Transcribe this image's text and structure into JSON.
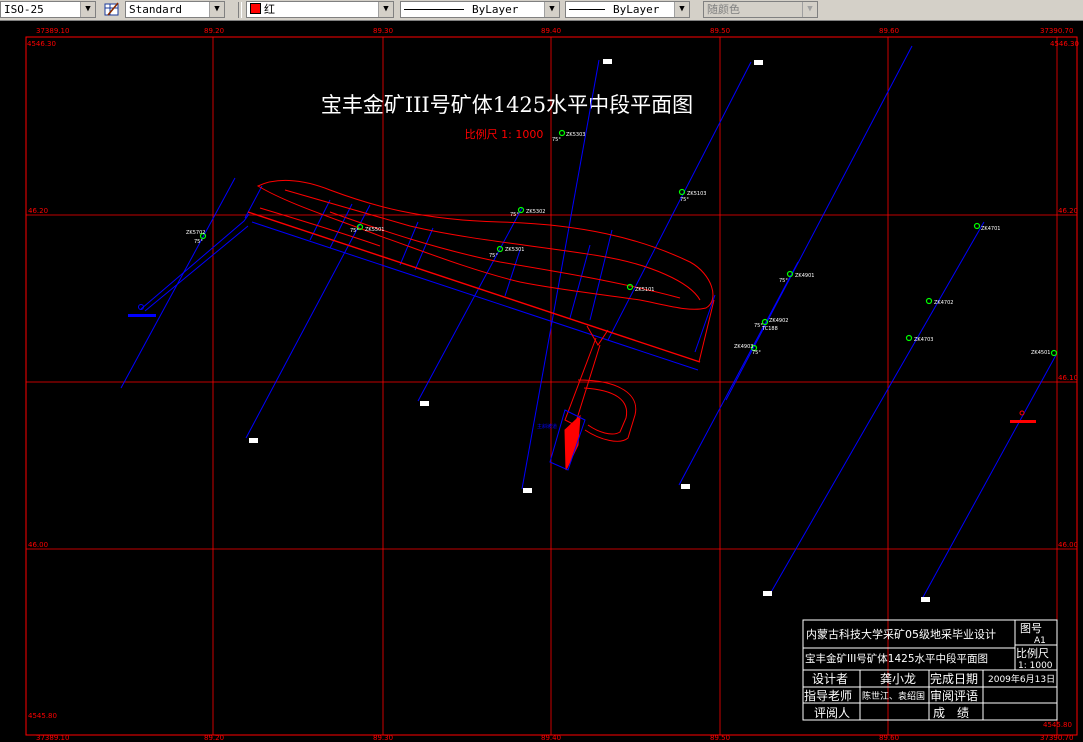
{
  "toolbar": {
    "dimstyle": "ISO-25",
    "tablestyle": "Standard",
    "color": "红",
    "linetype": "ByLayer",
    "lineweight": "ByLayer",
    "plotstyle": "随颜色",
    "icons": [
      "table-style-icon",
      "chevron-down-icon"
    ]
  },
  "drawing": {
    "title": "宝丰金矿III号矿体1425水平中段平面图",
    "scale": "比例尺 1: 1000",
    "colors": {
      "grid": "#ff0000",
      "lines": "#0000ff",
      "ore": "#ff0000",
      "points": "#00ff00",
      "text": "#ffffff"
    },
    "grid_labels": {
      "top_left_x": "37389.10",
      "top_left_y": "4546.30",
      "top_right_x": "37390.70",
      "top_right_y": "4546.30",
      "bottom_left_y": "4545.80",
      "bottom_left_x": "37389.10",
      "bottom_right_y": "4545.80",
      "bottom_right_x": "37390.70",
      "cols": [
        "89.20",
        "89.30",
        "89.40",
        "89.50",
        "89.60"
      ],
      "rows": [
        "46.20",
        "46.10",
        "46.00"
      ]
    },
    "point_labels": [
      "ZK5702",
      "ZK5501",
      "ZK5302",
      "ZK5303",
      "ZK5301",
      "ZK5101",
      "ZK5103",
      "ZK4901",
      "ZK4902",
      "ZK4903",
      "ZK4701",
      "ZK4702",
      "ZK4703",
      "ZK4501"
    ],
    "small_labels": [
      "75°",
      "75°",
      "75°",
      "75°",
      "75°",
      "75°",
      "75°",
      "75°",
      "75°",
      "TC188",
      "主斜坡道"
    ]
  },
  "title_block": {
    "school": "内蒙古科技大学采矿05级地采毕业设计",
    "drawing_name": "宝丰金矿III号矿体1425水平中段平面图",
    "sheet_label": "图号",
    "sheet_no": "A1",
    "scale_label": "比例尺",
    "scale_value": "1: 1000",
    "designer_label": "设计者",
    "designer": "龚小龙",
    "date_label": "完成日期",
    "date": "2009年6月13日",
    "advisor_label": "指导老师",
    "advisor": "陈世江、袁绍国",
    "review_label": "审阅评语",
    "reviewer_label": "评阅人",
    "grade_label": "成　绩"
  }
}
